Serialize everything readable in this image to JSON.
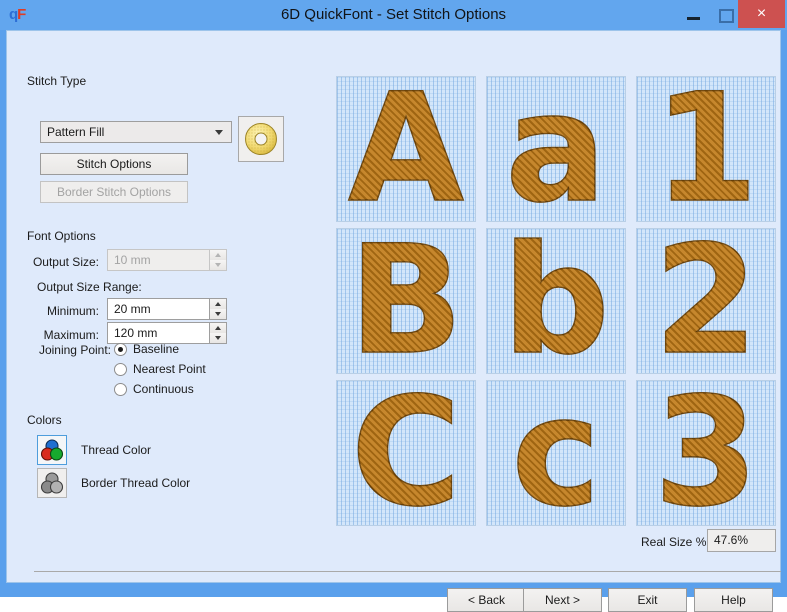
{
  "window": {
    "title": "6D QuickFont - Set Stitch Options",
    "logo_text_1": "q",
    "logo_text_2": "F",
    "minimize_label": "Minimize",
    "maximize_label": "Maximize",
    "close_label": "×",
    "titlebar_color": "#62a6ee",
    "close_color": "#cd5150",
    "client_color": "#dfeafb"
  },
  "stitch_type": {
    "section_label": "Stitch Type",
    "combo_value": "Pattern Fill",
    "stitch_options_label": "Stitch Options",
    "border_stitch_options_label": "Border Stitch Options",
    "sample_icon": "donut-pattern-fill-sample"
  },
  "font_options": {
    "section_label": "Font Options",
    "output_size_label": "Output Size:",
    "output_size_value": "10 mm",
    "output_size_range_label": "Output Size Range:",
    "minimum_label": "Minimum:",
    "minimum_value": "20 mm",
    "maximum_label": "Maximum:",
    "maximum_value": "120 mm"
  },
  "joining_point": {
    "label": "Joining Point:",
    "options": [
      {
        "label": "Baseline",
        "selected": true
      },
      {
        "label": "Nearest Point",
        "selected": false
      },
      {
        "label": "Continuous",
        "selected": false
      }
    ]
  },
  "colors": {
    "section_label": "Colors",
    "thread_color_label": "Thread Color",
    "border_thread_color_label": "Border Thread Color",
    "thread_swatch_colors": [
      "#1f6fd0",
      "#d82c1e",
      "#17a92e"
    ],
    "border_swatch_colors": [
      "#8e8e8e",
      "#6f6f6f",
      "#a5a5a5"
    ]
  },
  "preview": {
    "thread_color": "#c07a16",
    "background_color": "#d3e6fa",
    "cells": [
      {
        "glyph": "A"
      },
      {
        "glyph": "a"
      },
      {
        "glyph": "1"
      },
      {
        "glyph": "B"
      },
      {
        "glyph": "b"
      },
      {
        "glyph": "2"
      },
      {
        "glyph": "C"
      },
      {
        "glyph": "c"
      },
      {
        "glyph": "3"
      }
    ],
    "real_size_label": "Real Size %",
    "real_size_value": "47.6%"
  },
  "footer": {
    "back_label": "< Back",
    "next_label": "Next >",
    "exit_label": "Exit",
    "help_label": "Help"
  }
}
